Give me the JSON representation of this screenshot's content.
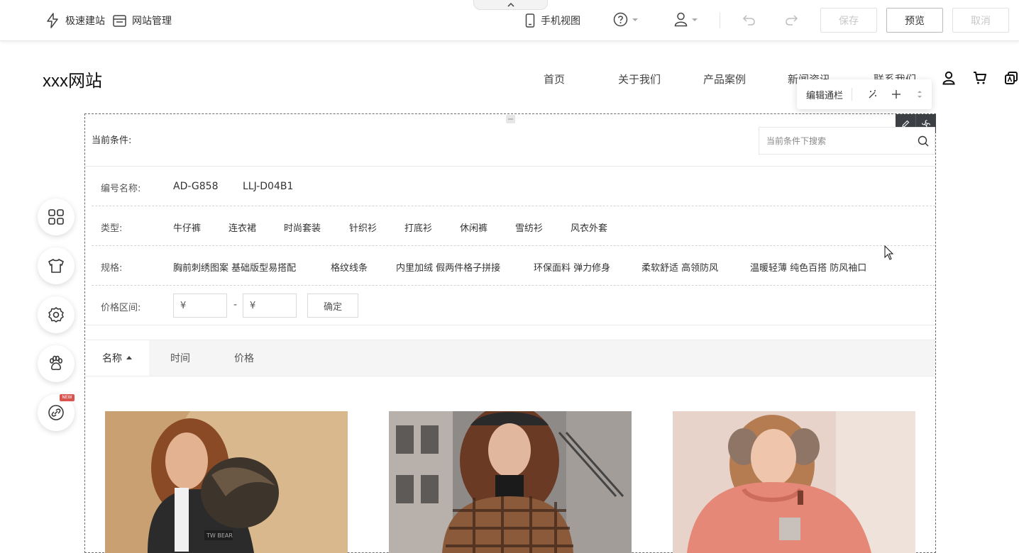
{
  "editor": {
    "quick_build": "极速建站",
    "site_manage": "网站管理",
    "mobile_view": "手机视图",
    "save": "保存",
    "preview": "预览",
    "cancel": "取消"
  },
  "site": {
    "logo": "xxx网站",
    "nav": [
      "首页",
      "关于我们",
      "产品案例",
      "新闻资讯",
      "联系我们"
    ]
  },
  "edit_bar": {
    "label": "编辑通栏"
  },
  "filter": {
    "current_label": "当前条件:",
    "search_placeholder": "当前条件下搜索",
    "rows": {
      "code": {
        "label": "编号名称:",
        "options": [
          "AD-G858",
          "LLJ-D04B1"
        ]
      },
      "type": {
        "label": "类型:",
        "options": [
          "牛仔裤",
          "连衣裙",
          "时尚套装",
          "针织衫",
          "打底衫",
          "休闲裤",
          "雪纺衫",
          "风衣外套"
        ]
      },
      "spec": {
        "label": "规格:",
        "options": [
          "胸前刺绣图案 基础版型易搭配",
          "格纹线条",
          "内里加绒 假两件格子拼接",
          "环保面料 弹力修身",
          "柔软舒适 高领防风",
          "温暖轻薄 纯色百搭 防风袖口"
        ]
      },
      "price": {
        "label": "价格区间:",
        "currency": "¥",
        "dash": "-",
        "confirm": "确定"
      }
    }
  },
  "sort": {
    "tabs": [
      "名称",
      "时间",
      "价格"
    ],
    "active": "名称"
  },
  "side_tools": {
    "new_badge": "NEW"
  },
  "product_logo_text": "TW BEAR",
  "colors": {
    "frame": "#6c6c6c",
    "toolbar_dark": "#3c3f44",
    "badge": "#d9534f"
  }
}
